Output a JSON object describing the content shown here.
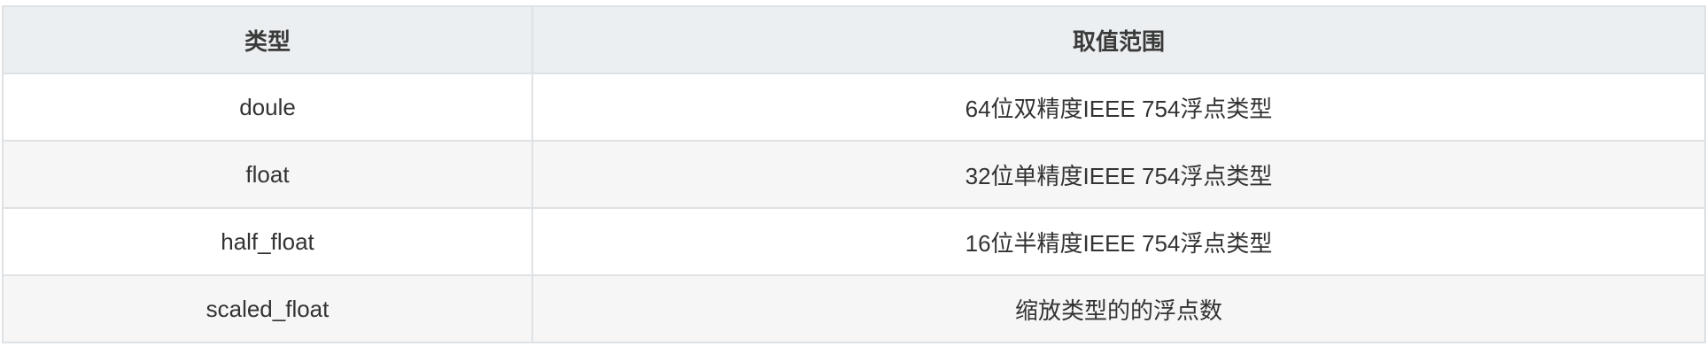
{
  "table": {
    "headers": [
      "类型",
      "取值范围"
    ],
    "rows": [
      [
        "doule",
        "64位双精度IEEE 754浮点类型"
      ],
      [
        "float",
        "32位单精度IEEE 754浮点类型"
      ],
      [
        "half_float",
        "16位半精度IEEE 754浮点类型"
      ],
      [
        "scaled_float",
        "缩放类型的的浮点数"
      ]
    ]
  }
}
